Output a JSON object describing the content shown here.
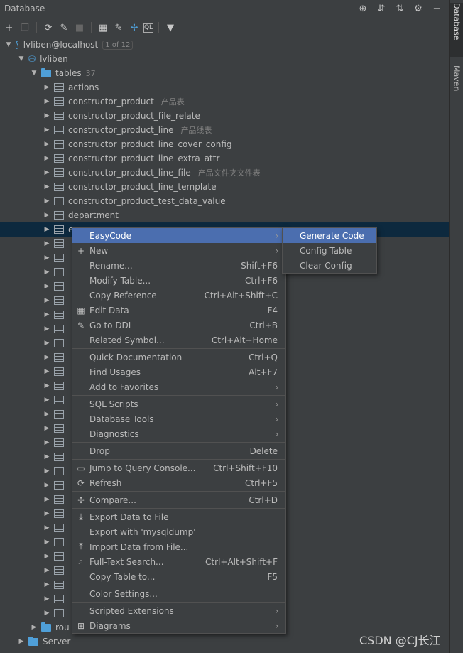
{
  "window": {
    "title": "Database"
  },
  "right_tabs": [
    "Database",
    "Maven"
  ],
  "connection": {
    "label": "lvliben@localhost",
    "badge": "1 of 12"
  },
  "schema": {
    "label": "lvliben"
  },
  "tables_folder": {
    "label": "tables",
    "count": "37"
  },
  "tables": [
    {
      "name": "actions",
      "comment": ""
    },
    {
      "name": "constructor_product",
      "comment": "产品表"
    },
    {
      "name": "constructor_product_file_relate",
      "comment": ""
    },
    {
      "name": "constructor_product_line",
      "comment": "产品线表"
    },
    {
      "name": "constructor_product_line_cover_config",
      "comment": ""
    },
    {
      "name": "constructor_product_line_extra_attr",
      "comment": ""
    },
    {
      "name": "constructor_product_line_file",
      "comment": "产品文件夹文件表"
    },
    {
      "name": "constructor_product_line_template",
      "comment": ""
    },
    {
      "name": "constructor_product_test_data_value",
      "comment": ""
    },
    {
      "name": "department",
      "comment": ""
    }
  ],
  "selected_row_partial": "e",
  "routines_partial": "rou",
  "server_partial": "Server",
  "context_menu": {
    "groups": [
      [
        {
          "label": "EasyCode",
          "shortcut": "",
          "submenu": true,
          "icon": "",
          "highlight": true
        },
        {
          "label": "New",
          "shortcut": "",
          "submenu": true,
          "icon": "plus-icon"
        },
        {
          "label": "Rename...",
          "shortcut": "Shift+F6"
        },
        {
          "label": "Modify Table...",
          "shortcut": "Ctrl+F6"
        },
        {
          "label": "Copy Reference",
          "shortcut": "Ctrl+Alt+Shift+C"
        },
        {
          "label": "Edit Data",
          "shortcut": "F4",
          "icon": "table-icon"
        },
        {
          "label": "Go to DDL",
          "shortcut": "Ctrl+B",
          "icon": "pencil-icon"
        },
        {
          "label": "Related Symbol...",
          "shortcut": "Ctrl+Alt+Home"
        }
      ],
      [
        {
          "label": "Quick Documentation",
          "shortcut": "Ctrl+Q"
        },
        {
          "label": "Find Usages",
          "shortcut": "Alt+F7"
        },
        {
          "label": "Add to Favorites",
          "shortcut": "",
          "submenu": true
        }
      ],
      [
        {
          "label": "SQL Scripts",
          "shortcut": "",
          "submenu": true
        },
        {
          "label": "Database Tools",
          "shortcut": "",
          "submenu": true
        },
        {
          "label": "Diagnostics",
          "shortcut": "",
          "submenu": true
        }
      ],
      [
        {
          "label": "Drop",
          "shortcut": "Delete"
        }
      ],
      [
        {
          "label": "Jump to Query Console...",
          "shortcut": "Ctrl+Shift+F10",
          "icon": "console-icon"
        },
        {
          "label": "Refresh",
          "shortcut": "Ctrl+F5",
          "icon": "refresh-icon"
        }
      ],
      [
        {
          "label": "Compare...",
          "shortcut": "Ctrl+D",
          "icon": "compare-icon"
        }
      ],
      [
        {
          "label": "Export Data to File",
          "shortcut": "",
          "icon": "export-icon"
        },
        {
          "label": "Export with 'mysqldump'",
          "shortcut": ""
        },
        {
          "label": "Import Data from File...",
          "shortcut": "",
          "icon": "import-icon"
        },
        {
          "label": "Full-Text Search...",
          "shortcut": "Ctrl+Alt+Shift+F",
          "icon": "search-icon"
        },
        {
          "label": "Copy Table to...",
          "shortcut": "F5"
        }
      ],
      [
        {
          "label": "Color Settings...",
          "shortcut": ""
        }
      ],
      [
        {
          "label": "Scripted Extensions",
          "shortcut": "",
          "submenu": true
        },
        {
          "label": "Diagrams",
          "shortcut": "",
          "submenu": true,
          "icon": "diagram-icon"
        }
      ]
    ]
  },
  "submenu": {
    "items": [
      {
        "label": "Generate Code",
        "highlight": true
      },
      {
        "label": "Config Table"
      },
      {
        "label": "Clear Config"
      }
    ]
  },
  "watermark": "CSDN @CJ长江"
}
